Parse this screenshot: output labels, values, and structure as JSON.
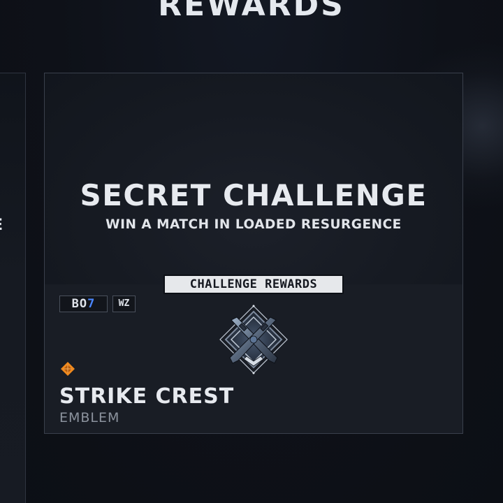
{
  "header": {
    "title": "REWARDS"
  },
  "side_card": {
    "label_fragment": "E"
  },
  "challenge": {
    "title": "SECRET CHALLENGE",
    "subtitle": "WIN A MATCH IN LOADED RESURGENCE",
    "rewards_label": "CHALLENGE REWARDS"
  },
  "badges": {
    "bo7_prefix": "BO",
    "bo7_suffix": "7",
    "wz": "WZ"
  },
  "reward": {
    "name": "STRIKE CREST",
    "type": "EMBLEM",
    "rarity_icon": "rarity-diamond-icon",
    "emblem_icon": "crossed-rifles-emblem-icon"
  },
  "colors": {
    "background": "#10131a",
    "card_border": "#3a404c",
    "text_primary": "#e7eaef",
    "text_secondary": "#8c939e",
    "bo7_accent": "#4a86ff",
    "rarity_orange": "#f08a1e",
    "tag_background": "#e6e8eb"
  }
}
